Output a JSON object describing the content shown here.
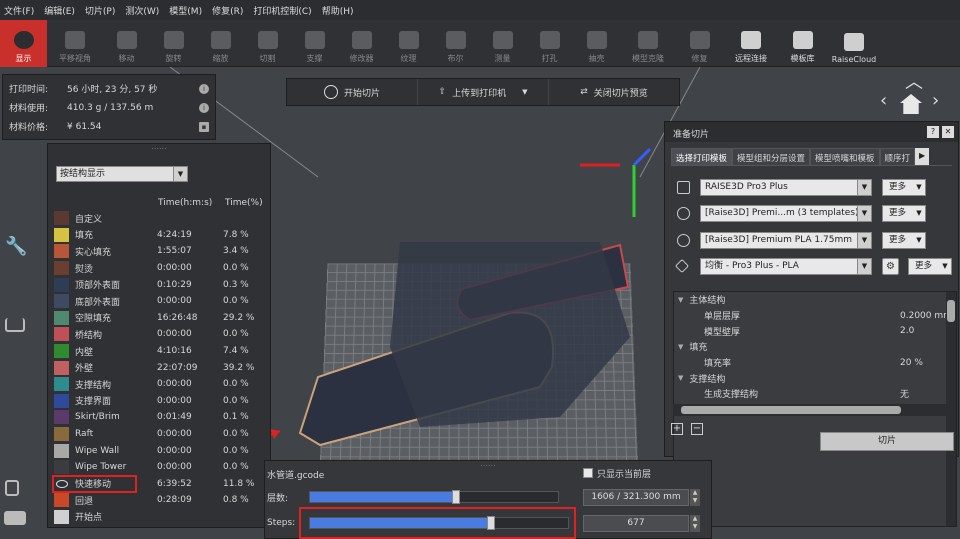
{
  "menu": [
    "文件(F)",
    "编辑(E)",
    "切片(P)",
    "测次(W)",
    "模型(M)",
    "修复(R)",
    "打印机控制(C)",
    "帮助(H)"
  ],
  "toolbar": [
    {
      "label": "显示",
      "active": true
    },
    {
      "label": "平移视角"
    },
    {
      "label": "移动"
    },
    {
      "label": "旋转"
    },
    {
      "label": "缩放"
    },
    {
      "label": "切割"
    },
    {
      "label": "支撑"
    },
    {
      "label": "修改器"
    },
    {
      "label": "纹理"
    },
    {
      "label": "布尔"
    },
    {
      "label": "测量"
    },
    {
      "label": "打孔"
    },
    {
      "label": "抽壳"
    },
    {
      "label": "模型克隆"
    },
    {
      "label": "修复"
    },
    {
      "label": "远程连接",
      "bright": true
    },
    {
      "label": "模板库",
      "bright": true
    },
    {
      "label": "RaiseCloud",
      "bright": true
    }
  ],
  "info": {
    "print_time_label": "打印时间:",
    "print_time": "56 小时, 23 分, 57 秒",
    "material_label": "材料使用:",
    "material": "410.3 g / 137.56 m",
    "cost_label": "材料价格:",
    "cost": "¥ 61.54"
  },
  "actions": {
    "start": "开始切片",
    "upload": "上传到打印机",
    "close": "关闭切片预览"
  },
  "legend": {
    "dropdown": "按结构显示",
    "col_time": "Time(h:m:s)",
    "col_pct": "Time(%)",
    "rows": [
      {
        "name": "自定义",
        "time": "",
        "pct": "",
        "color": "#5a3a30"
      },
      {
        "name": "填充",
        "time": "4:24:19",
        "pct": "7.8 %",
        "color": "#d4c240"
      },
      {
        "name": "实心填充",
        "time": "1:55:07",
        "pct": "3.4 %",
        "color": "#b8563a"
      },
      {
        "name": "熨烫",
        "time": "0:00:00",
        "pct": "0.0 %",
        "color": "#6a3e30"
      },
      {
        "name": "顶部外表面",
        "time": "0:10:29",
        "pct": "0.3 %",
        "color": "#2e3d55"
      },
      {
        "name": "底部外表面",
        "time": "0:00:00",
        "pct": "0.0 %",
        "color": "#3e4a62"
      },
      {
        "name": "空隙填充",
        "time": "16:26:48",
        "pct": "29.2 %",
        "color": "#4f8a70"
      },
      {
        "name": "桥结构",
        "time": "0:00:00",
        "pct": "0.0 %",
        "color": "#c05058"
      },
      {
        "name": "内壁",
        "time": "4:10:16",
        "pct": "7.4 %",
        "color": "#2e8c2e"
      },
      {
        "name": "外壁",
        "time": "22:07:09",
        "pct": "39.2 %",
        "color": "#c06060"
      },
      {
        "name": "支撑结构",
        "time": "0:00:00",
        "pct": "0.0 %",
        "color": "#2e8c8c"
      },
      {
        "name": "支撑界面",
        "time": "0:00:00",
        "pct": "0.0 %",
        "color": "#2e4a9a"
      },
      {
        "name": "Skirt/Brim",
        "time": "0:01:49",
        "pct": "0.1 %",
        "color": "#5a3a6a"
      },
      {
        "name": "Raft",
        "time": "0:00:00",
        "pct": "0.0 %",
        "color": "#8a6a3a"
      },
      {
        "name": "Wipe Wall",
        "time": "0:00:00",
        "pct": "0.0 %",
        "color": "#a8a8a8"
      },
      {
        "name": "Wipe Tower",
        "time": "0:00:00",
        "pct": "0.0 %",
        "color": "#3a3c40"
      },
      {
        "name": "快速移动",
        "time": "6:39:52",
        "pct": "11.8 %",
        "color": "eye"
      },
      {
        "name": "回退",
        "time": "0:28:09",
        "pct": "0.8 %",
        "color": "#c84828"
      },
      {
        "name": "开始点",
        "time": "",
        "pct": "",
        "color": "#d0d0d0"
      }
    ]
  },
  "prep": {
    "title": "准备切片",
    "tabs": [
      "选择打印模板",
      "模型组和分层设置",
      "模型喷嘴和模板",
      "顺序打"
    ],
    "printer": "RAISE3D Pro3 Plus",
    "template": "[Raise3D] Premi...m (3 templates)",
    "filament": "[Raise3D] Premium PLA 1.75mm",
    "profile": "均衡 - Pro3 Plus - PLA",
    "more": "更多",
    "tree": [
      {
        "type": "cat",
        "name": "主体结构"
      },
      {
        "type": "item",
        "name": "单层层厚",
        "val": "0.2000 mm"
      },
      {
        "type": "item",
        "name": "模型壁厚",
        "val": "2.0"
      },
      {
        "type": "cat",
        "name": "填充"
      },
      {
        "type": "item",
        "name": "填充率",
        "val": "20 %"
      },
      {
        "type": "cat",
        "name": "支撑结构"
      },
      {
        "type": "item",
        "name": "生成支撑结构",
        "val": "无"
      }
    ],
    "slice": "切片"
  },
  "bottom": {
    "file": "水管道.gcode",
    "only_layer": "只显示当前层",
    "layer_label": "层数:",
    "layer_value": "1606 / 321.300 mm",
    "layer_fraction": 0.59,
    "steps_label": "Steps:",
    "steps_value": "677",
    "steps_fraction": 0.7
  }
}
